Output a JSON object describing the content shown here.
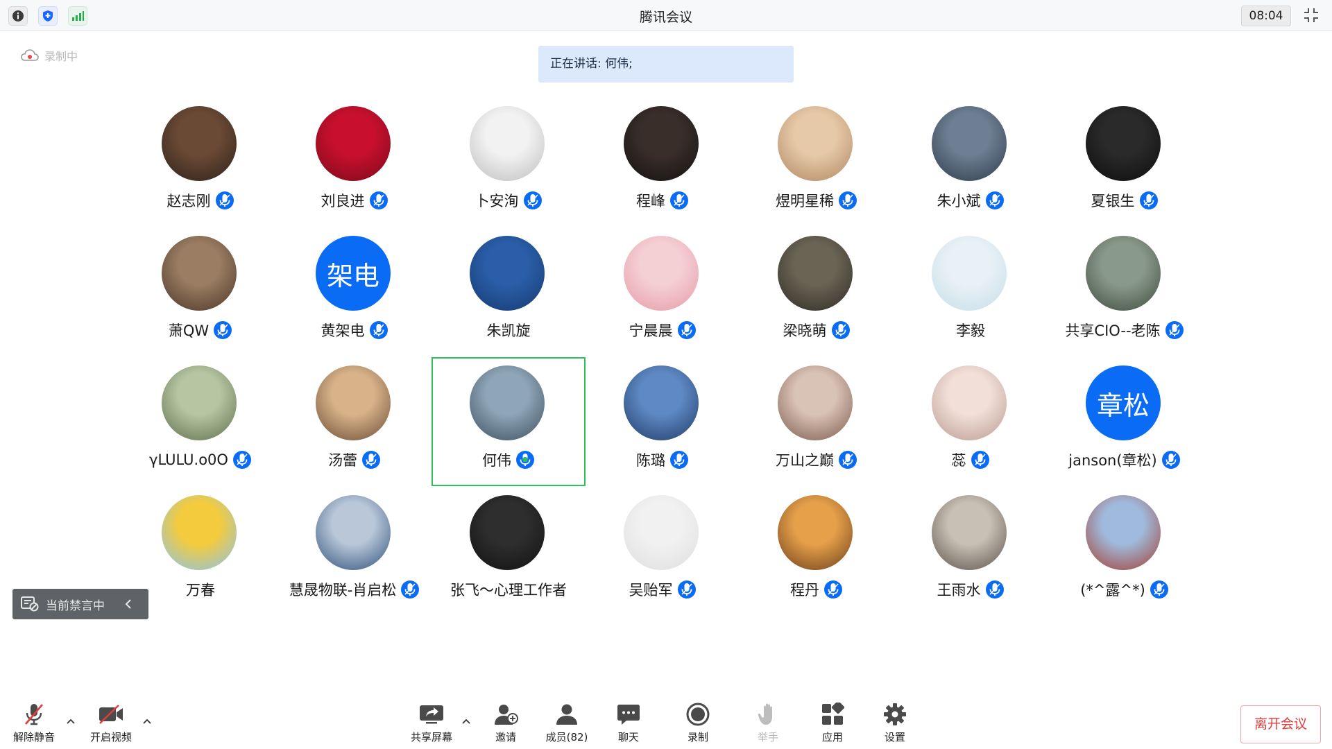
{
  "titlebar": {
    "title": "腾讯会议",
    "timer": "08:04",
    "icons": [
      "info-icon",
      "shield-icon",
      "signal-icon",
      "fullscreen-icon"
    ]
  },
  "recording": {
    "label": "录制中"
  },
  "speaking": {
    "label": "正在讲话: 何伟;"
  },
  "participants": [
    {
      "name": "赵志刚",
      "mic": true
    },
    {
      "name": "刘良进",
      "mic": true
    },
    {
      "name": "卜安洵",
      "mic": true
    },
    {
      "name": "程峰",
      "mic": true
    },
    {
      "name": "煜明星稀",
      "mic": true
    },
    {
      "name": "朱小斌",
      "mic": true
    },
    {
      "name": "夏银生",
      "mic": true
    },
    {
      "name": "萧QW",
      "mic": true
    },
    {
      "name": "黄架电",
      "mic": true,
      "initials": "架电"
    },
    {
      "name": "朱凯旋",
      "mic": false
    },
    {
      "name": "宁晨晨",
      "mic": true
    },
    {
      "name": "梁晓萌",
      "mic": true
    },
    {
      "name": "李毅",
      "mic": false
    },
    {
      "name": "共享CIO--老陈",
      "mic": true
    },
    {
      "name": "γLULU.o0O",
      "mic": true
    },
    {
      "name": "汤蕾",
      "mic": true
    },
    {
      "name": "何伟",
      "mic": true,
      "speaking": true
    },
    {
      "name": "陈璐",
      "mic": true
    },
    {
      "name": "万山之巅",
      "mic": true
    },
    {
      "name": "蕊",
      "mic": true
    },
    {
      "name": "janson(章松)",
      "mic": true,
      "initials": "章松"
    },
    {
      "name": "万春",
      "mic": false
    },
    {
      "name": "慧晟物联-肖启松",
      "mic": true
    },
    {
      "name": "张飞～心理工作者",
      "mic": false
    },
    {
      "name": "吴贻军",
      "mic": true
    },
    {
      "name": "程丹",
      "mic": true
    },
    {
      "name": "王雨水",
      "mic": true
    },
    {
      "name": "(*^露^*)",
      "mic": true
    }
  ],
  "chat_banned": {
    "label": "当前禁言中"
  },
  "toolbar": {
    "unmute": "解除静音",
    "video": "开启视频",
    "share": "共享屏幕",
    "invite": "邀请",
    "members": "成员(82)",
    "chat": "聊天",
    "record": "录制",
    "raise_hand": "举手",
    "apps": "应用",
    "settings": "设置",
    "leave": "离开会议"
  },
  "colors": {
    "accent_blue": "#0a6cf5",
    "speaking_bg": "#dce9fc",
    "active_border": "#2fbf5a",
    "leave_red": "#e23b3b"
  }
}
